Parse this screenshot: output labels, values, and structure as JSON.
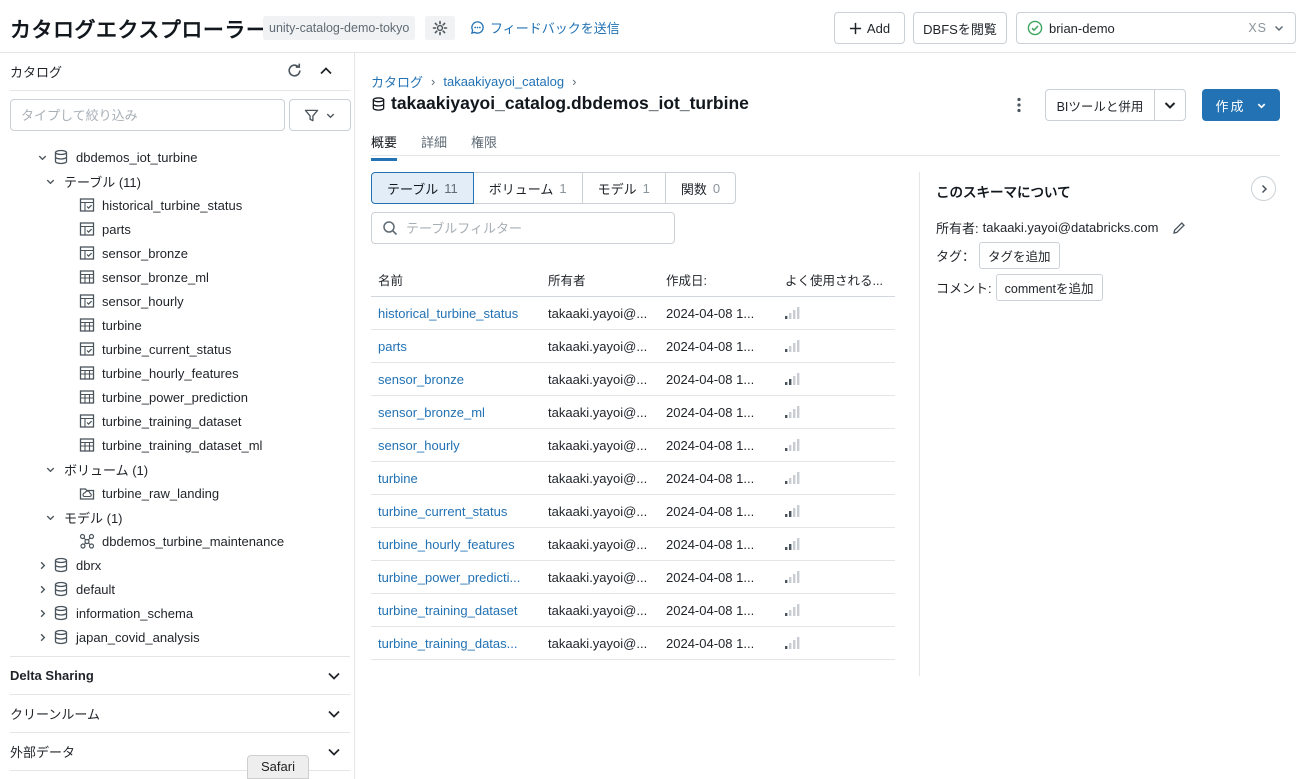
{
  "header": {
    "title": "カタログエクスプローラー",
    "workspace": "unity-catalog-demo-tokyo",
    "feedback": "フィードバックを送信",
    "add_label": "Add",
    "dbfs_label": "DBFSを閲覧",
    "cluster_name": "brian-demo",
    "cluster_size": "XS"
  },
  "sidebar": {
    "catalog_label": "カタログ",
    "filter_placeholder": "タイプして絞り込み",
    "tree": [
      {
        "level": 1,
        "caret": "down",
        "icon": "db",
        "label": "dbdemos_iot_turbine"
      },
      {
        "level": 2,
        "caret": "down",
        "icon": "",
        "label": "テーブル (11)"
      },
      {
        "level": 3,
        "caret": "",
        "icon": "view",
        "label": "historical_turbine_status"
      },
      {
        "level": 3,
        "caret": "",
        "icon": "view",
        "label": "parts"
      },
      {
        "level": 3,
        "caret": "",
        "icon": "view",
        "label": "sensor_bronze"
      },
      {
        "level": 3,
        "caret": "",
        "icon": "table",
        "label": "sensor_bronze_ml"
      },
      {
        "level": 3,
        "caret": "",
        "icon": "view",
        "label": "sensor_hourly"
      },
      {
        "level": 3,
        "caret": "",
        "icon": "table",
        "label": "turbine"
      },
      {
        "level": 3,
        "caret": "",
        "icon": "view",
        "label": "turbine_current_status"
      },
      {
        "level": 3,
        "caret": "",
        "icon": "table",
        "label": "turbine_hourly_features"
      },
      {
        "level": 3,
        "caret": "",
        "icon": "table",
        "label": "turbine_power_prediction"
      },
      {
        "level": 3,
        "caret": "",
        "icon": "view",
        "label": "turbine_training_dataset"
      },
      {
        "level": 3,
        "caret": "",
        "icon": "table",
        "label": "turbine_training_dataset_ml"
      },
      {
        "level": 2,
        "caret": "down",
        "icon": "",
        "label": "ボリューム (1)"
      },
      {
        "level": 3,
        "caret": "",
        "icon": "volume",
        "label": "turbine_raw_landing"
      },
      {
        "level": 2,
        "caret": "down",
        "icon": "",
        "label": "モデル (1)"
      },
      {
        "level": 3,
        "caret": "",
        "icon": "model",
        "label": "dbdemos_turbine_maintenance"
      },
      {
        "level": 1,
        "caret": "right",
        "icon": "db",
        "label": "dbrx"
      },
      {
        "level": 1,
        "caret": "right",
        "icon": "db",
        "label": "default"
      },
      {
        "level": 1,
        "caret": "right",
        "icon": "db",
        "label": "information_schema"
      },
      {
        "level": 1,
        "caret": "right",
        "icon": "db",
        "label": "japan_covid_analysis"
      }
    ],
    "sections": [
      "Delta Sharing",
      "クリーンルーム",
      "外部データ"
    ],
    "safari_tooltip": "Safari"
  },
  "main": {
    "breadcrumb": [
      "カタログ",
      "takaakiyayoi_catalog"
    ],
    "title": "takaakiyayoi_catalog.dbdemos_iot_turbine",
    "bi_label": "BIツールと併用",
    "create_label": "作成",
    "tabs": [
      "概要",
      "詳細",
      "権限"
    ],
    "segments": [
      {
        "label": "テーブル",
        "count": "11"
      },
      {
        "label": "ボリューム",
        "count": "1"
      },
      {
        "label": "モデル",
        "count": "1"
      },
      {
        "label": "関数",
        "count": "0"
      }
    ],
    "table_filter_placeholder": "テーブルフィルター",
    "columns": [
      "名前",
      "所有者",
      "作成日:",
      "よく使用される..."
    ],
    "rows": [
      {
        "name": "historical_turbine_status",
        "owner": "takaaki.yayoi@...",
        "created": "2024-04-08 1...",
        "usage": 1
      },
      {
        "name": "parts",
        "owner": "takaaki.yayoi@...",
        "created": "2024-04-08 1...",
        "usage": 1
      },
      {
        "name": "sensor_bronze",
        "owner": "takaaki.yayoi@...",
        "created": "2024-04-08 1...",
        "usage": 2
      },
      {
        "name": "sensor_bronze_ml",
        "owner": "takaaki.yayoi@...",
        "created": "2024-04-08 1...",
        "usage": 1
      },
      {
        "name": "sensor_hourly",
        "owner": "takaaki.yayoi@...",
        "created": "2024-04-08 1...",
        "usage": 1
      },
      {
        "name": "turbine",
        "owner": "takaaki.yayoi@...",
        "created": "2024-04-08 1...",
        "usage": 1
      },
      {
        "name": "turbine_current_status",
        "owner": "takaaki.yayoi@...",
        "created": "2024-04-08 1...",
        "usage": 2
      },
      {
        "name": "turbine_hourly_features",
        "owner": "takaaki.yayoi@...",
        "created": "2024-04-08 1...",
        "usage": 2
      },
      {
        "name": "turbine_power_predicti...",
        "owner": "takaaki.yayoi@...",
        "created": "2024-04-08 1...",
        "usage": 1
      },
      {
        "name": "turbine_training_dataset",
        "owner": "takaaki.yayoi@...",
        "created": "2024-04-08 1...",
        "usage": 1
      },
      {
        "name": "turbine_training_datas...",
        "owner": "takaaki.yayoi@...",
        "created": "2024-04-08 1...",
        "usage": 1
      }
    ]
  },
  "about": {
    "title": "このスキーマについて",
    "owner_label": "所有者:",
    "owner_value": "takaaki.yayoi@databricks.com",
    "tag_label": "タグ：",
    "tag_button": "タグを追加",
    "comment_label": "コメント:",
    "comment_button": "commentを追加"
  },
  "colors": {
    "accent": "#2272b4",
    "border": "#cbd1d6",
    "success": "#3ba65e"
  }
}
